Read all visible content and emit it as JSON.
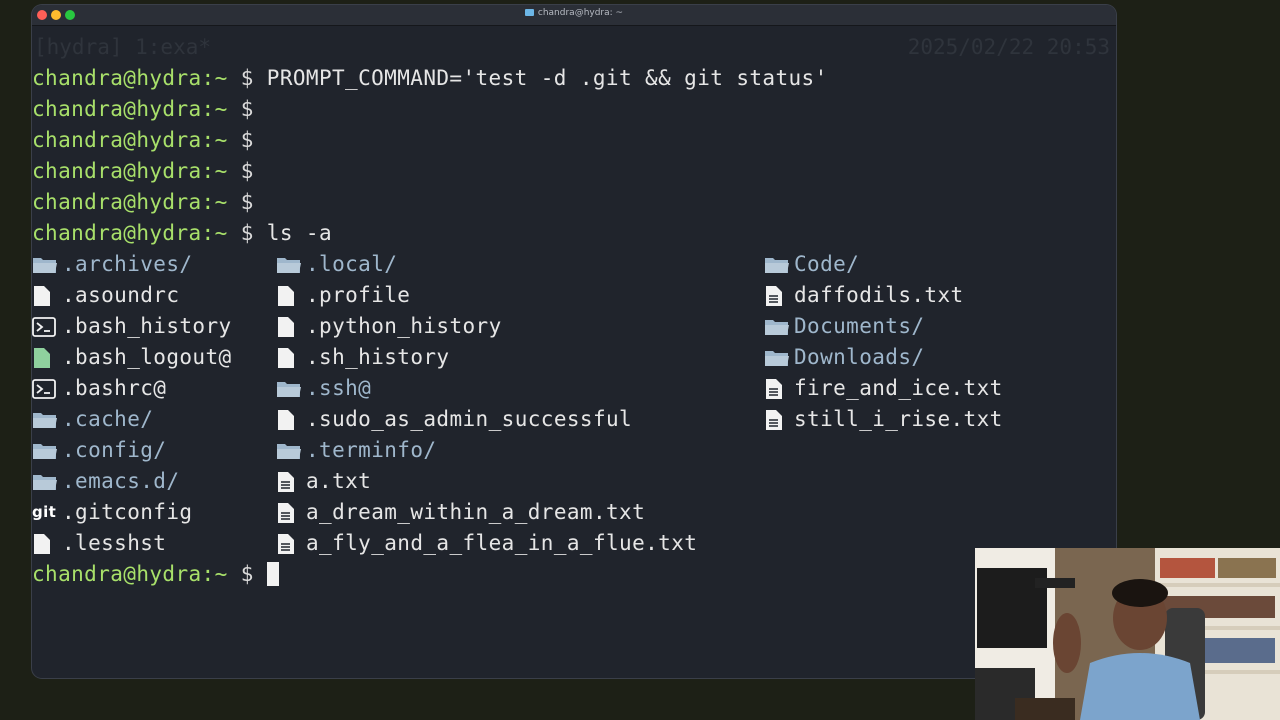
{
  "window": {
    "title": "chandra@hydra: ~",
    "status_left": "[hydra] 1:exa*",
    "status_right": "2025/02/22 20:53"
  },
  "prompt": "chandra@hydra:~",
  "dollar": "$",
  "lines": [
    {
      "cmd": "PROMPT_COMMAND='test -d .git && git status'"
    },
    {
      "cmd": ""
    },
    {
      "cmd": ""
    },
    {
      "cmd": ""
    },
    {
      "cmd": ""
    },
    {
      "cmd": "ls -a"
    }
  ],
  "listing": {
    "col1": [
      {
        "name": ".archives/",
        "icon": "folder-icon",
        "type": "dir"
      },
      {
        "name": ".asoundrc",
        "icon": "file-icon",
        "type": "file"
      },
      {
        "name": ".bash_history",
        "icon": "terminal-icon",
        "type": "file"
      },
      {
        "name": ".bash_logout@",
        "icon": "file-icon",
        "type": "link"
      },
      {
        "name": ".bashrc@",
        "icon": "terminal-icon",
        "type": "link"
      },
      {
        "name": ".cache/",
        "icon": "folder-icon",
        "type": "dir"
      },
      {
        "name": ".config/",
        "icon": "folder-icon",
        "type": "dir"
      },
      {
        "name": ".emacs.d/",
        "icon": "folder-icon",
        "type": "dir"
      },
      {
        "name": ".gitconfig",
        "icon": "git-icon",
        "icon_text": "git",
        "type": "file"
      },
      {
        "name": ".lesshst",
        "icon": "file-icon",
        "type": "file"
      }
    ],
    "col2": [
      {
        "name": ".local/",
        "icon": "folder-icon",
        "type": "dir"
      },
      {
        "name": ".profile",
        "icon": "file-icon",
        "type": "file"
      },
      {
        "name": ".python_history",
        "icon": "file-icon",
        "type": "file"
      },
      {
        "name": ".sh_history",
        "icon": "file-icon",
        "type": "file"
      },
      {
        "name": ".ssh@",
        "icon": "folder-icon",
        "type": "dir"
      },
      {
        "name": ".sudo_as_admin_successful",
        "icon": "file-icon",
        "type": "file"
      },
      {
        "name": ".terminfo/",
        "icon": "folder-icon",
        "type": "dir"
      },
      {
        "name": "a.txt",
        "icon": "text-file-icon",
        "type": "file"
      },
      {
        "name": "a_dream_within_a_dream.txt",
        "icon": "text-file-icon",
        "type": "file"
      },
      {
        "name": "a_fly_and_a_flea_in_a_flue.txt",
        "icon": "text-file-icon",
        "type": "file"
      }
    ],
    "col3": [
      {
        "name": "Code/",
        "icon": "folder-icon",
        "type": "dir"
      },
      {
        "name": "daffodils.txt",
        "icon": "text-file-icon",
        "type": "file"
      },
      {
        "name": "Documents/",
        "icon": "folder-icon",
        "type": "dir"
      },
      {
        "name": "Downloads/",
        "icon": "folder-icon",
        "type": "dir"
      },
      {
        "name": "fire_and_ice.txt",
        "icon": "text-file-icon",
        "type": "file"
      },
      {
        "name": "still_i_rise.txt",
        "icon": "text-file-icon",
        "type": "file"
      }
    ]
  },
  "colors": {
    "prompt": "#a8e06a",
    "dir": "#9fb7cc",
    "file": "#e6e6e6",
    "accent_green": "#8fd19e"
  }
}
